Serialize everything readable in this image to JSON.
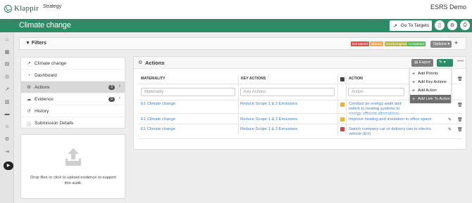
{
  "app": {
    "logo_text": "Klappir",
    "product": "Strategy",
    "environment": "ESRS Demo",
    "page_title": "Climate change",
    "go_to_targets_label": "Go To Targets"
  },
  "colors": {
    "brand_green": "#2e8b66",
    "not_started": "#d9534f",
    "started": "#f0ad4e",
    "good_progress": "#c9c94a",
    "completed": "#5cb85c"
  },
  "filters": {
    "label": "Filters",
    "badges": [
      "Not started",
      "Started",
      "Good progress",
      "Completed"
    ],
    "options_label": "Options",
    "add_icon": "plus-icon"
  },
  "sidenav": {
    "items": [
      {
        "label": "Climate change",
        "icon": "chart-line-icon"
      },
      {
        "label": "Dashboard",
        "icon": "dashboard-icon"
      },
      {
        "label": "Actions",
        "icon": "gear-icon",
        "count": "3"
      },
      {
        "label": "Evidence",
        "icon": "cloud-upload-icon",
        "count": "0"
      },
      {
        "label": "History",
        "icon": "history-icon"
      },
      {
        "label": "Submission Details",
        "icon": "info-icon"
      }
    ]
  },
  "upload": {
    "text": "Drop files or click to upload evidence to support this audit."
  },
  "actions_panel": {
    "title": "Actions",
    "export_label": "Export",
    "columns": {
      "materiality": "MATERIALITY",
      "key_actions": "KEY ACTIONS",
      "action": "ACTION"
    },
    "placeholders": {
      "materiality": "Materiality",
      "key_actions": "Key Actions",
      "action": "Action"
    },
    "rows": [
      {
        "materiality": "E1 Climate change",
        "key_action": "Reduce Scope 1 & 2 Emissions",
        "action": "Conduct an energy audit and switch to heating systems to energy-efficient alternatives.",
        "status_color": "#f0b429"
      },
      {
        "materiality": "E1 Climate change",
        "key_action": "Reduce Scope 1 & 2 Emissions",
        "action": "Improve heating and insulation in office space",
        "status_color": "#f0b429"
      },
      {
        "materiality": "E1 Climate change",
        "key_action": "Reduce Scope 1 & 2 Emissions",
        "action": "Switch company car or delivery van to electric vehicle (EV)",
        "status_color": "#d64541"
      }
    ]
  },
  "dropdown": {
    "items": [
      "Add Priority",
      "Add Key Actions",
      "Add Action",
      "Add Link To Action"
    ]
  }
}
